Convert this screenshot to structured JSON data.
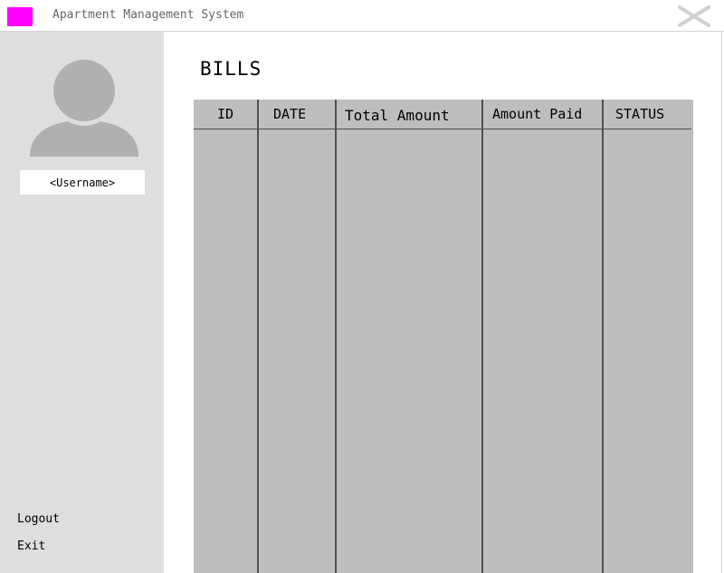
{
  "window": {
    "title": "Apartment Management System",
    "logo_color": "#ff00ff",
    "close_icon": "close-icon"
  },
  "sidebar": {
    "avatar_icon": "user-avatar-icon",
    "username": "<Username>",
    "links": {
      "logout": "Logout",
      "exit": "Exit"
    }
  },
  "main": {
    "title": "BILLS",
    "table": {
      "columns": [
        "ID",
        "DATE",
        "Total Amount",
        "Amount Paid",
        "STATUS"
      ],
      "rows": []
    }
  }
}
